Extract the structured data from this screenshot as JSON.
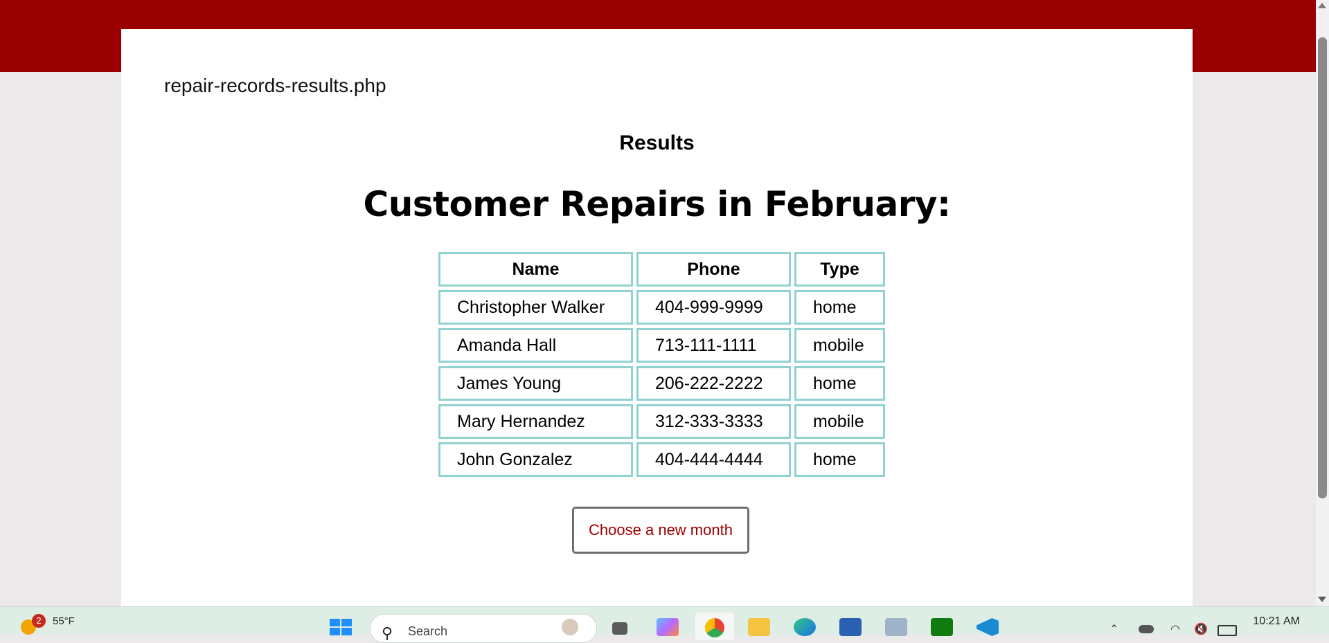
{
  "page": {
    "file_title": "repair-records-results.php",
    "results_heading": "Results",
    "main_heading": "Customer Repairs in February:",
    "table": {
      "headers": [
        "Name",
        "Phone",
        "Type"
      ],
      "rows": [
        [
          "Christopher Walker",
          "404-999-9999",
          "home"
        ],
        [
          "Amanda Hall",
          "713-111-1111",
          "mobile"
        ],
        [
          "James Young",
          "206-222-2222",
          "home"
        ],
        [
          "Mary Hernandez",
          "312-333-3333",
          "mobile"
        ],
        [
          "John Gonzalez",
          "404-444-4444",
          "home"
        ]
      ]
    },
    "button_label": "Choose a new month"
  },
  "taskbar": {
    "weather_badge": "2",
    "weather_temp": "55°F",
    "search_placeholder": "Search",
    "clock_time": "10:21 AM",
    "icons": [
      "windows-start-icon",
      "search-icon",
      "task-view-icon",
      "copilot-icon",
      "chrome-icon",
      "file-explorer-icon",
      "edge-icon",
      "microsoft-store-icon",
      "security-app-icon",
      "xbox-icon",
      "vscode-icon",
      "chevron-up-icon",
      "onedrive-icon",
      "wifi-icon",
      "volume-muted-icon",
      "battery-icon"
    ]
  },
  "colors": {
    "top_band": "#990000",
    "table_border": "#8fd2cf",
    "button_text": "#a00000",
    "page_background": "#ebe9ea"
  }
}
